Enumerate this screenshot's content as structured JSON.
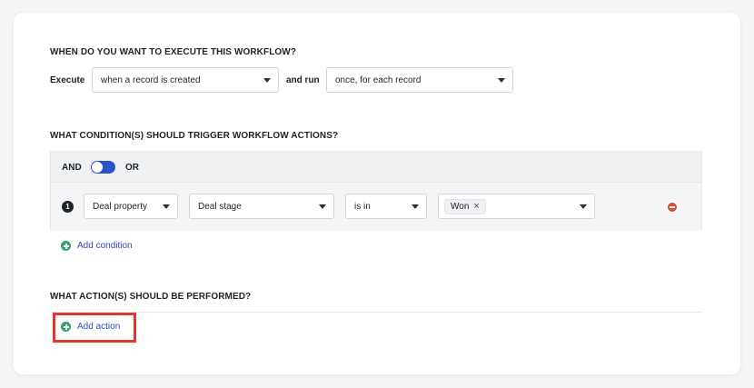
{
  "execute_section": {
    "title": "WHEN DO YOU WANT TO EXECUTE THIS WORKFLOW?",
    "execute_label": "Execute",
    "trigger_value": "when a record is created",
    "run_label": "and run",
    "run_value": "once, for each record"
  },
  "condition_section": {
    "title": "WHAT CONDITION(S) SHOULD TRIGGER WORKFLOW ACTIONS?",
    "and_label": "AND",
    "or_label": "OR",
    "toggle_state": "OR",
    "conditions": [
      {
        "index": "1",
        "object": "Deal property",
        "field": "Deal stage",
        "operator": "is in",
        "values": [
          "Won"
        ]
      }
    ],
    "add_condition_label": "Add condition"
  },
  "action_section": {
    "title": "WHAT ACTION(S) SHOULD BE PERFORMED?",
    "add_action_label": "Add action"
  },
  "colors": {
    "accent_blue": "#2b55c7",
    "link_blue": "#2a4db5",
    "add_green": "#2fa56a",
    "remove_red": "#d94b3b",
    "highlight_red": "#e0392b"
  },
  "icons": {
    "dropdown": "caret-down-icon",
    "remove": "minus-circle-icon",
    "add": "plus-circle-icon",
    "chip_remove": "close-icon"
  }
}
